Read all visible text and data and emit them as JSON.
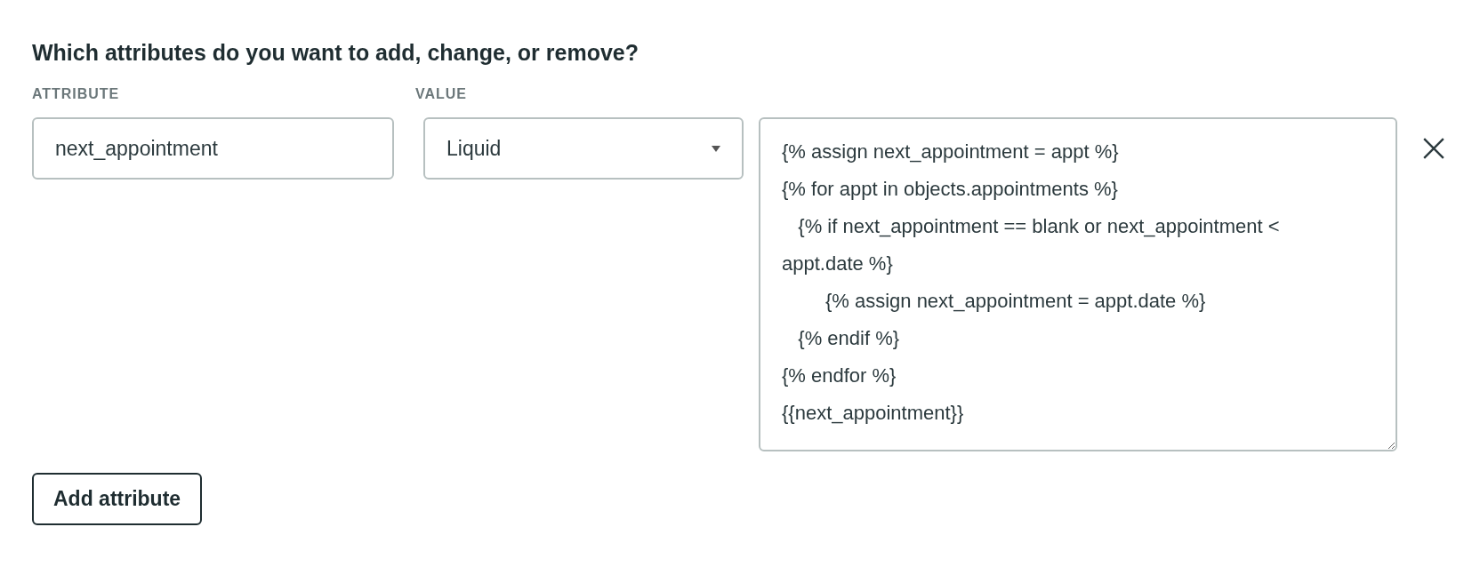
{
  "heading": "Which attributes do you want to add, change, or remove?",
  "columns": [
    "ATTRIBUTE",
    "VALUE"
  ],
  "rows": [
    {
      "attribute": "next_appointment",
      "value_type": "Liquid",
      "value": "{% assign next_appointment = appt %}\n{% for appt in objects.appointments %}\n   {% if next_appointment == blank or next_appointment < appt.date %}\n        {% assign next_appointment = appt.date %}\n   {% endif %}\n{% endfor %}\n{{next_appointment}}"
    }
  ],
  "add_button": "Add attribute"
}
